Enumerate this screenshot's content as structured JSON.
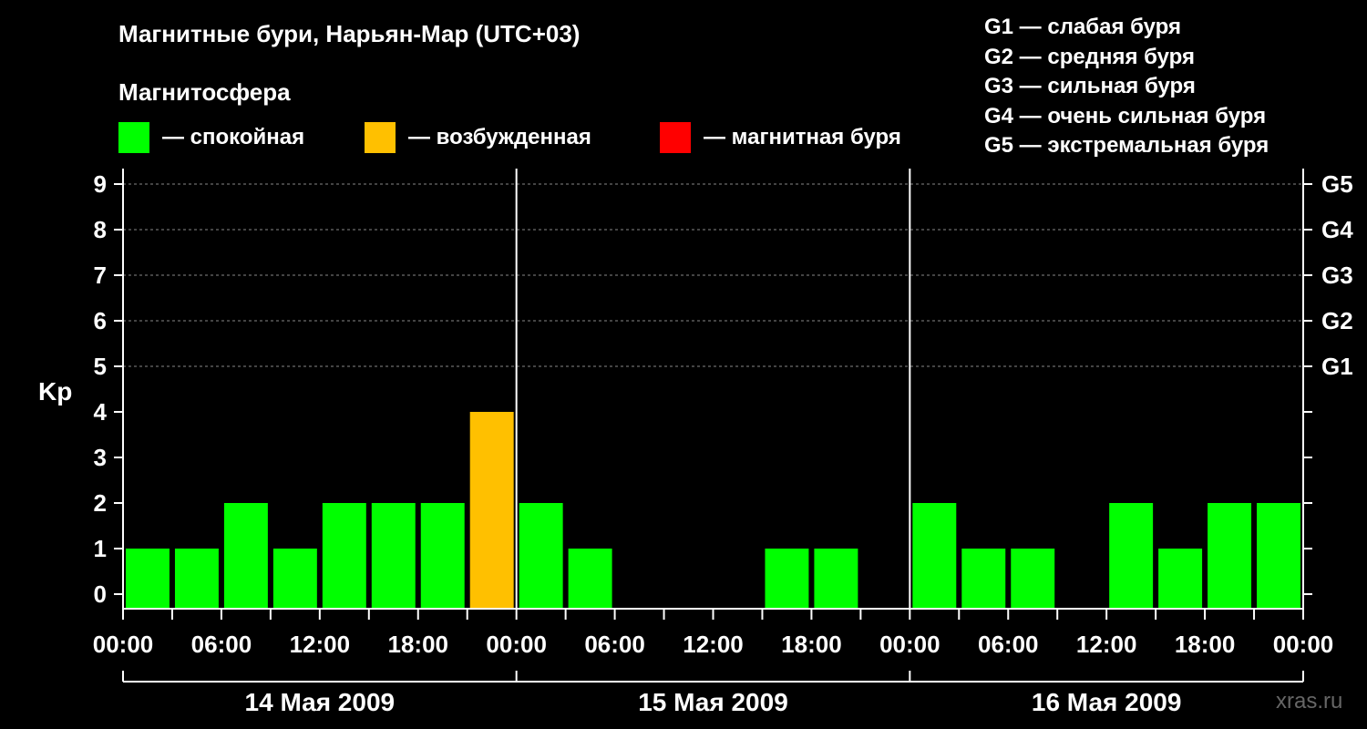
{
  "title": "Магнитные бури, Нарьян-Мар (UTC+03)",
  "subtitle": "Магнитосфера",
  "legend": [
    {
      "label": "— спокойная",
      "color": "#00ff00"
    },
    {
      "label": "— возбужденная",
      "color": "#ffc000"
    },
    {
      "label": "— магнитная буря",
      "color": "#ff0000"
    }
  ],
  "g_legend": [
    "G1 — слабая буря",
    "G2 — средняя буря",
    "G3 — сильная буря",
    "G4 — очень сильная буря",
    "G5 — экстремальная буря"
  ],
  "watermark": "xras.ru",
  "chart_data": {
    "type": "bar",
    "ylabel": "Kp",
    "ylim": [
      0,
      9
    ],
    "yticks": [
      "0",
      "1",
      "2",
      "3",
      "4",
      "5",
      "6",
      "7",
      "8",
      "9"
    ],
    "g_scale": [
      {
        "kp": 5,
        "label": "G1"
      },
      {
        "kp": 6,
        "label": "G2"
      },
      {
        "kp": 7,
        "label": "G3"
      },
      {
        "kp": 8,
        "label": "G4"
      },
      {
        "kp": 9,
        "label": "G5"
      }
    ],
    "xtick_labels": [
      "00:00",
      "06:00",
      "12:00",
      "18:00",
      "00:00",
      "06:00",
      "12:00",
      "18:00",
      "00:00",
      "06:00",
      "12:00",
      "18:00",
      "00:00"
    ],
    "days": [
      "14 Мая 2009",
      "15 Мая 2009",
      "16 Мая 2009"
    ],
    "interval_hours": 3,
    "values": [
      1,
      1,
      2,
      1,
      2,
      2,
      2,
      4,
      2,
      1,
      0,
      0,
      0,
      1,
      1,
      0,
      2,
      1,
      1,
      0,
      2,
      1,
      2,
      2
    ],
    "colors": {
      "quiet": "#00ff00",
      "unsettled": "#ffc000",
      "storm": "#ff0000"
    },
    "grid": true
  }
}
